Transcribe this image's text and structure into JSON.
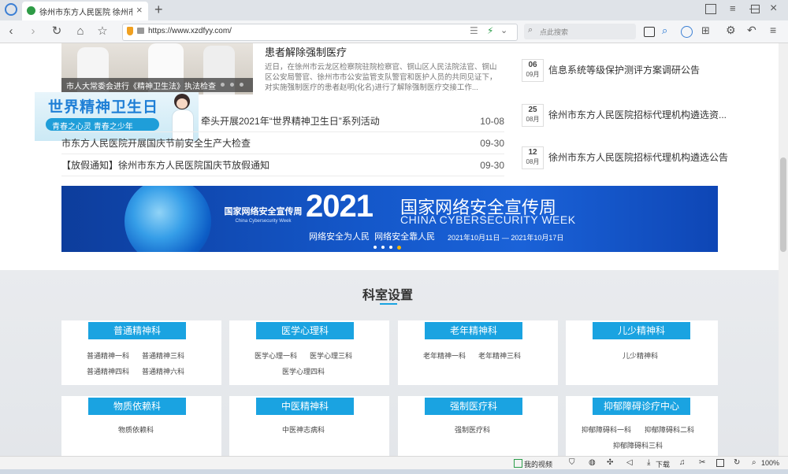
{
  "browser": {
    "tab_title": "徐州市东方人民医院 徐州市精神",
    "url": "https://www.xzdfyy.com/",
    "search_placeholder": "点此搜索",
    "zoom": "100%",
    "status_items": [
      "我的视频",
      "下载"
    ]
  },
  "featured": {
    "headline": "患者解除强制医疗",
    "summary": "近日，在徐州市云龙区检察院驻院检察官、铜山区人民法院法官、铜山区公安局警官、徐州市市公安监管支队警官和医护人员的共同见证下，对实施强制医疗的患者赵明(化名)进行了解除强制医疗交接工作..."
  },
  "slider": {
    "caption": "市人大常委会进行《精神卫生法》执法检查",
    "poster_title": "世界精神卫生日",
    "poster_slogan": "青春之心灵 青春之少年"
  },
  "news": [
    {
      "title": "牵头开展2021年“世界精神卫生日”系列活动",
      "date": "10-08"
    },
    {
      "title": "市东方人民医院开展国庆节前安全生产大检查",
      "date": "09-30"
    },
    {
      "title": "【放假通知】徐州市东方人民医院国庆节放假通知",
      "date": "09-30"
    }
  ],
  "notices": [
    {
      "day": "06",
      "month": "09月",
      "title": "信息系统等级保护测评方案调研公告"
    },
    {
      "day": "25",
      "month": "08月",
      "title": "徐州市东方人民医院招标代理机构遴选资..."
    },
    {
      "day": "12",
      "month": "08月",
      "title": "徐州市东方人民医院招标代理机构遴选公告"
    }
  ],
  "banner": {
    "left_title": "国家网络安全宣传周",
    "left_sub": "China Cybersecurity Week",
    "year": "2021",
    "title": "国家网络安全宣传周",
    "title_en": "CHINA CYBERSECURITY WEEK",
    "slogan": "网络安全为人民  网络安全靠人民",
    "dates": "2021年10月11日 — 2021年10月17日"
  },
  "departments": {
    "heading": "科室设置",
    "items": [
      {
        "name": "普通精神科",
        "links": [
          "普通精神一科",
          "普通精神三科",
          "普通精神四科",
          "普通精神六科"
        ]
      },
      {
        "name": "医学心理科",
        "links": [
          "医学心理一科",
          "医学心理三科",
          "医学心理四科"
        ]
      },
      {
        "name": "老年精神科",
        "links": [
          "老年精神一科",
          "老年精神三科"
        ]
      },
      {
        "name": "儿少精神科",
        "links": [
          "儿少精神科"
        ]
      },
      {
        "name": "物质依赖科",
        "links": [
          "物质依赖科"
        ]
      },
      {
        "name": "中医精神科",
        "links": [
          "中医神志病科"
        ]
      },
      {
        "name": "强制医疗科",
        "links": [
          "强制医疗科"
        ]
      },
      {
        "name": "抑郁障碍诊疗中心",
        "links": [
          "抑郁障碍科一科",
          "抑郁障碍科二科",
          "抑郁障碍科三科"
        ]
      }
    ]
  },
  "colors": {
    "accent": "#1aa3e1",
    "banner_blue": "#1457c9"
  }
}
